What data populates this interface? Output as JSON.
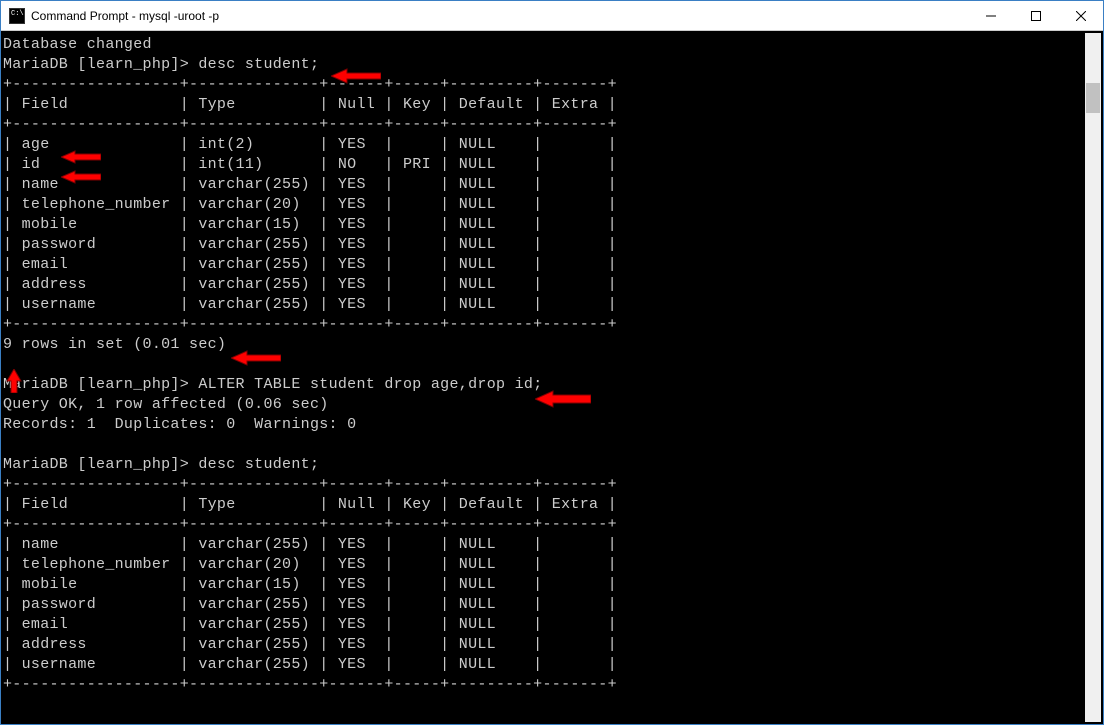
{
  "window": {
    "title": "Command Prompt - mysql  -uroot -p"
  },
  "lines": {
    "dbchanged": "Database changed",
    "prompt": "MariaDB [learn_php]> ",
    "cmd_desc1": "desc student;",
    "cmd_alter": "ALTER TABLE student drop age,drop id;",
    "cmd_desc2": "desc student;",
    "rows_msg1": "9 rows in set (0.01 sec)",
    "query_ok": "Query OK, 1 row affected (0.06 sec)",
    "records": "Records: 1  Duplicates: 0  Warnings: 0"
  },
  "table_sep": {
    "border": "+------------------+--------------+------+-----+---------+-------+",
    "header": "| Field            | Type         | Null | Key | Default | Extra |"
  },
  "table1_rows": [
    "| age              | int(2)       | YES  |     | NULL    |       |",
    "| id               | int(11)      | NO   | PRI | NULL    |       |",
    "| name             | varchar(255) | YES  |     | NULL    |       |",
    "| telephone_number | varchar(20)  | YES  |     | NULL    |       |",
    "| mobile           | varchar(15)  | YES  |     | NULL    |       |",
    "| password         | varchar(255) | YES  |     | NULL    |       |",
    "| email            | varchar(255) | YES  |     | NULL    |       |",
    "| address          | varchar(255) | YES  |     | NULL    |       |",
    "| username         | varchar(255) | YES  |     | NULL    |       |"
  ],
  "table2_rows": [
    "| name             | varchar(255) | YES  |     | NULL    |       |",
    "| telephone_number | varchar(20)  | YES  |     | NULL    |       |",
    "| mobile           | varchar(15)  | YES  |     | NULL    |       |",
    "| password         | varchar(255) | YES  |     | NULL    |       |",
    "| email            | varchar(255) | YES  |     | NULL    |       |",
    "| address          | varchar(255) | YES  |     | NULL    |       |",
    "| username         | varchar(255) | YES  |     | NULL    |       |"
  ],
  "arrow_color": "#ff0000"
}
